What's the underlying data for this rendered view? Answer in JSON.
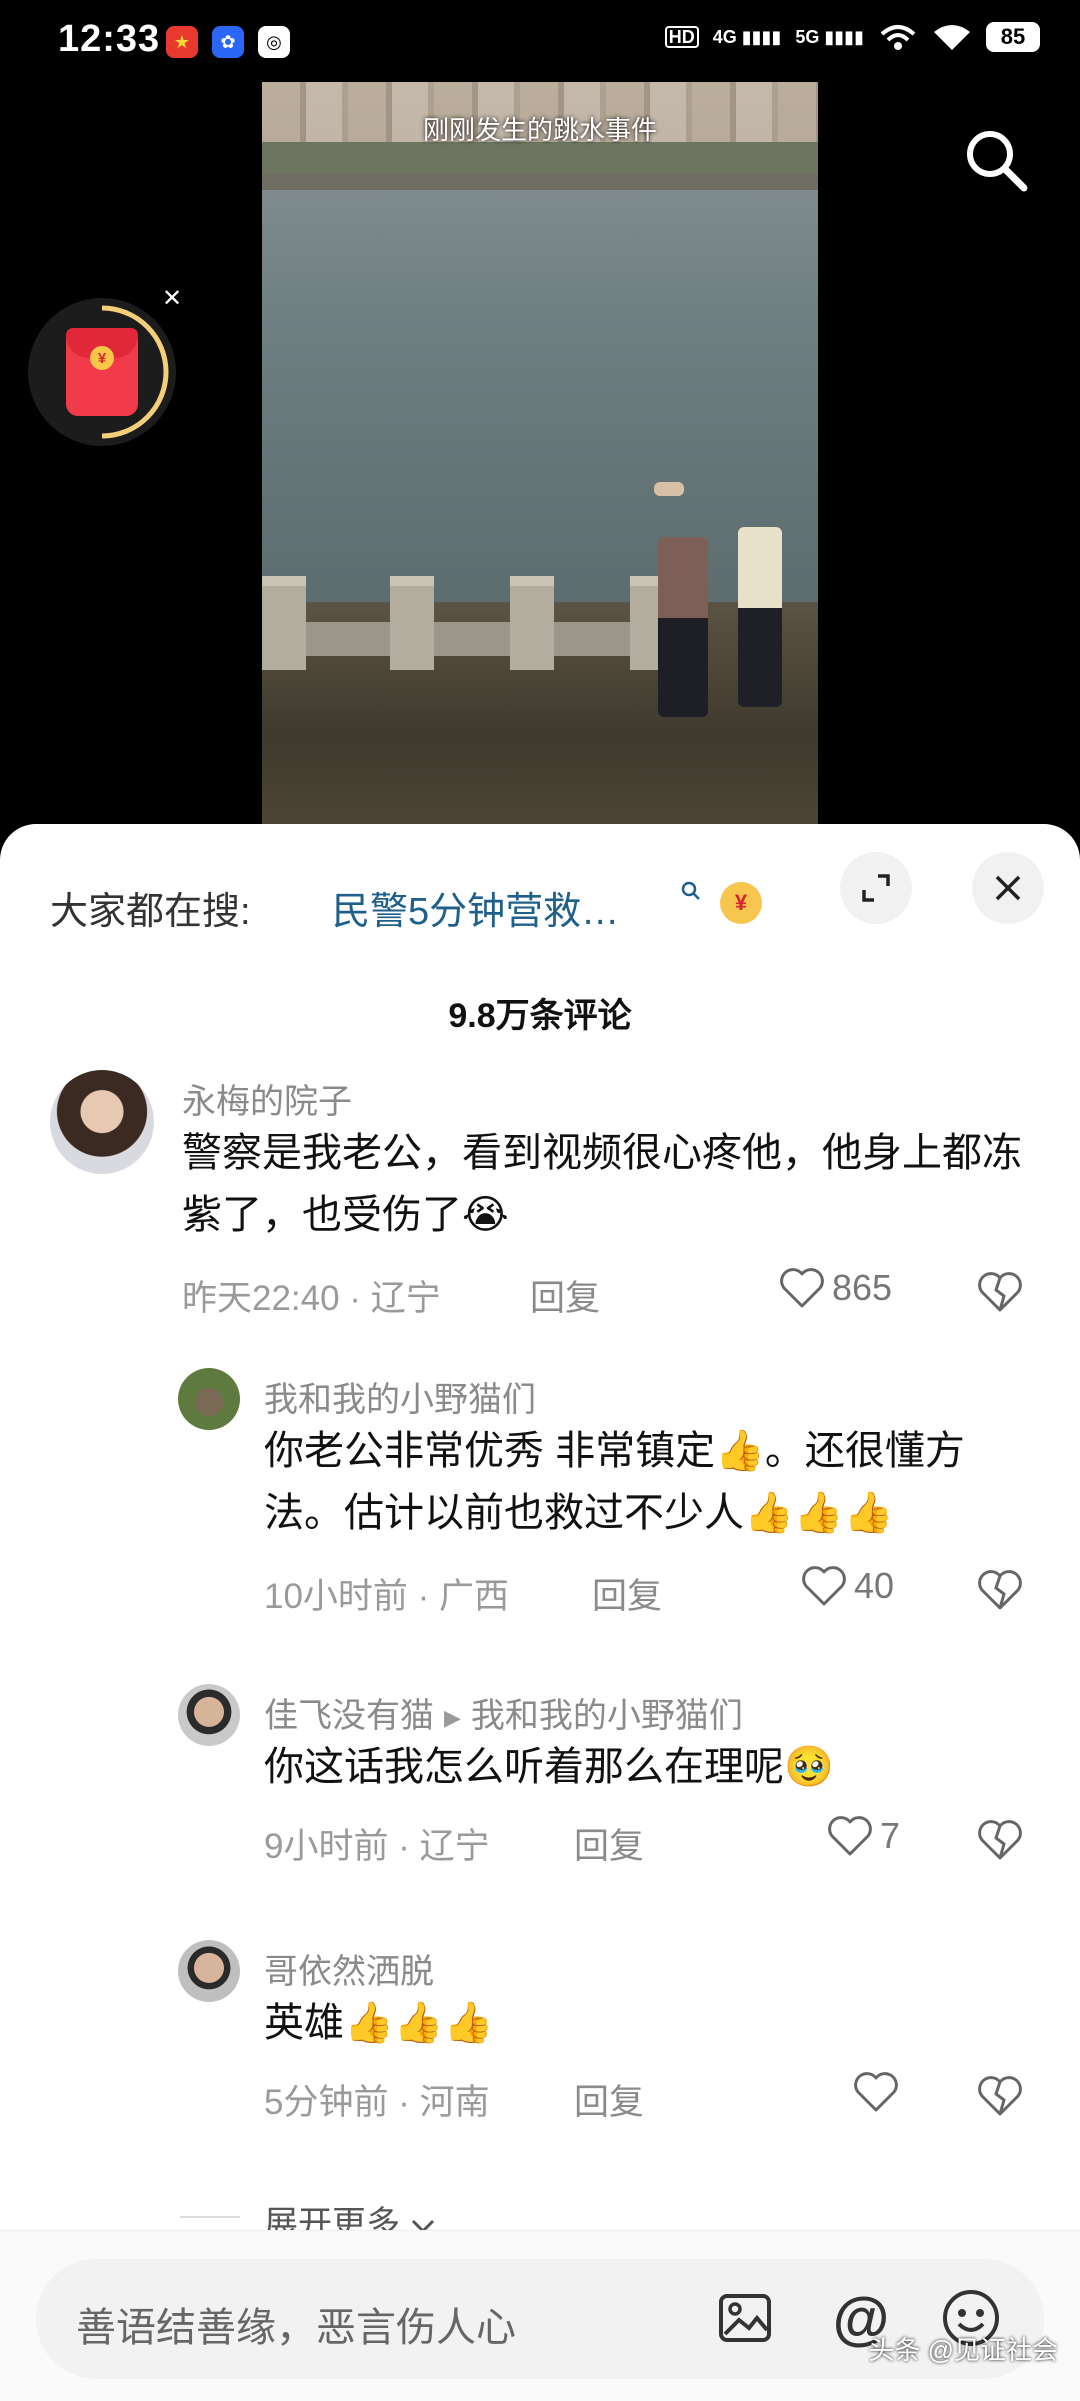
{
  "status_bar": {
    "time": "12:33",
    "network_hd": "HD",
    "network_4g": "4G",
    "network_5g": "5G",
    "battery": "85"
  },
  "video": {
    "caption": "刚刚发生的跳水事件"
  },
  "hot_search": {
    "label": "大家都在搜:",
    "link": "民警5分钟营救…",
    "coin": "¥"
  },
  "comments": {
    "count_label": "9.8万条评论",
    "items": [
      {
        "name": "永梅的院子",
        "text": "警察是我老公，看到视频很心疼他，他身上都冻紫了，也受伤了😭",
        "meta": "昨天22:40 · 辽宁",
        "reply": "回复",
        "likes": "865"
      },
      {
        "name": "我和我的小野猫们",
        "text": "你老公非常优秀 非常镇定👍。还很懂方法。估计以前也救过不少人👍👍👍",
        "meta": "10小时前 · 广西",
        "reply": "回复",
        "likes": "40"
      },
      {
        "name": "佳飞没有猫",
        "reply_to": "我和我的小野猫们",
        "text": "你这话我怎么听着那么在理呢🥹",
        "meta": "9小时前 · 辽宁",
        "reply": "回复",
        "likes": "7"
      },
      {
        "name": "哥依然洒脱",
        "text": "英雄👍👍👍",
        "meta": "5分钟前 · 河南",
        "reply": "回复",
        "likes": ""
      }
    ],
    "expand_more": "展开更多"
  },
  "input": {
    "placeholder": "善语结善缘，恶言伤人心"
  },
  "watermark": "头条 @见证社会"
}
